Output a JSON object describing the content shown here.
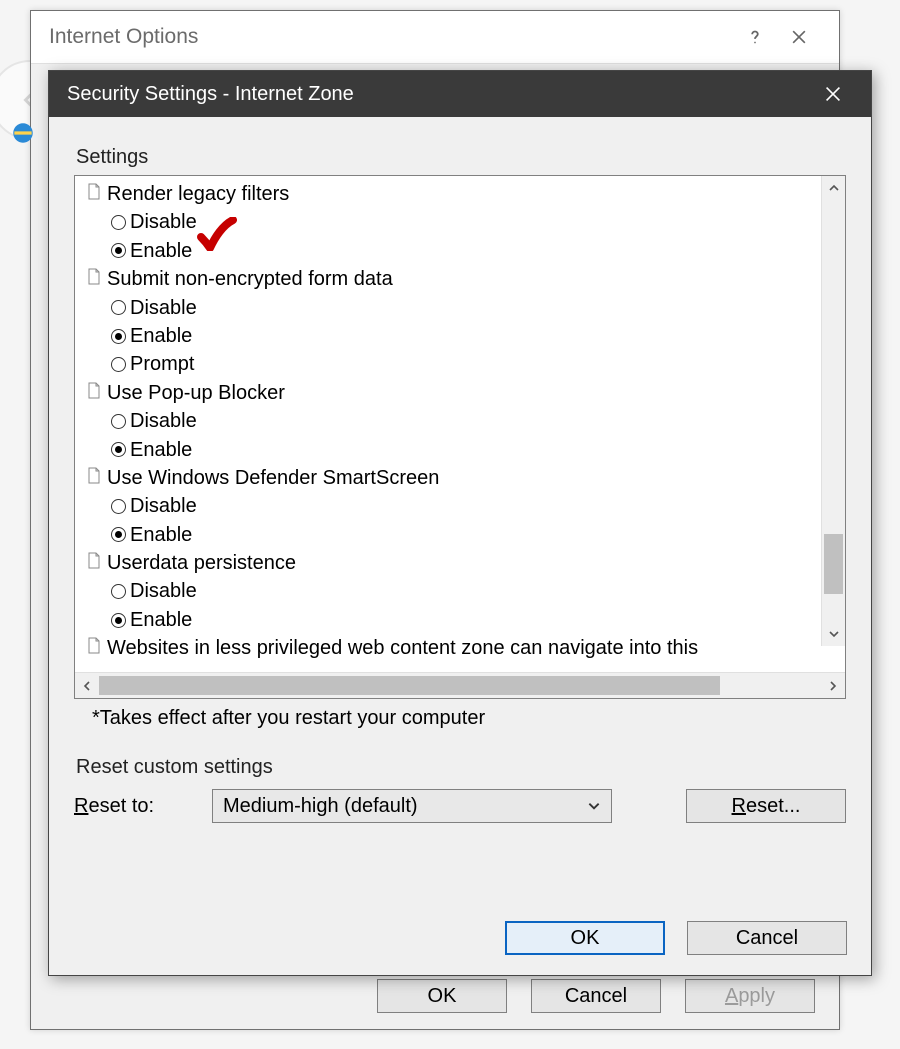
{
  "parent": {
    "title": "Internet Options",
    "buttons": {
      "ok": "OK",
      "cancel": "Cancel",
      "apply": "Apply"
    }
  },
  "dialog": {
    "title": "Security Settings - Internet Zone",
    "group_label": "Settings",
    "footnote": "*Takes effect after you restart your computer",
    "settings": [
      {
        "label": "Render legacy filters",
        "selected": "Enable",
        "options": [
          "Disable",
          "Enable"
        ],
        "annotated": true
      },
      {
        "label": "Submit non-encrypted form data",
        "selected": "Enable",
        "options": [
          "Disable",
          "Enable",
          "Prompt"
        ]
      },
      {
        "label": "Use Pop-up Blocker",
        "selected": "Enable",
        "options": [
          "Disable",
          "Enable"
        ]
      },
      {
        "label": "Use Windows Defender SmartScreen",
        "selected": "Enable",
        "options": [
          "Disable",
          "Enable"
        ]
      },
      {
        "label": "Userdata persistence",
        "selected": "Enable",
        "options": [
          "Disable",
          "Enable"
        ]
      },
      {
        "label": "Websites in less privileged web content zone can navigate into this",
        "options": [],
        "truncated": true
      }
    ],
    "reset": {
      "group_label": "Reset custom settings",
      "label_prefix": "R",
      "label_rest": "eset to:",
      "combo_value": "Medium-high (default)",
      "button_prefix": "R",
      "button_rest": "eset..."
    },
    "buttons": {
      "ok": "OK",
      "cancel": "Cancel"
    }
  }
}
